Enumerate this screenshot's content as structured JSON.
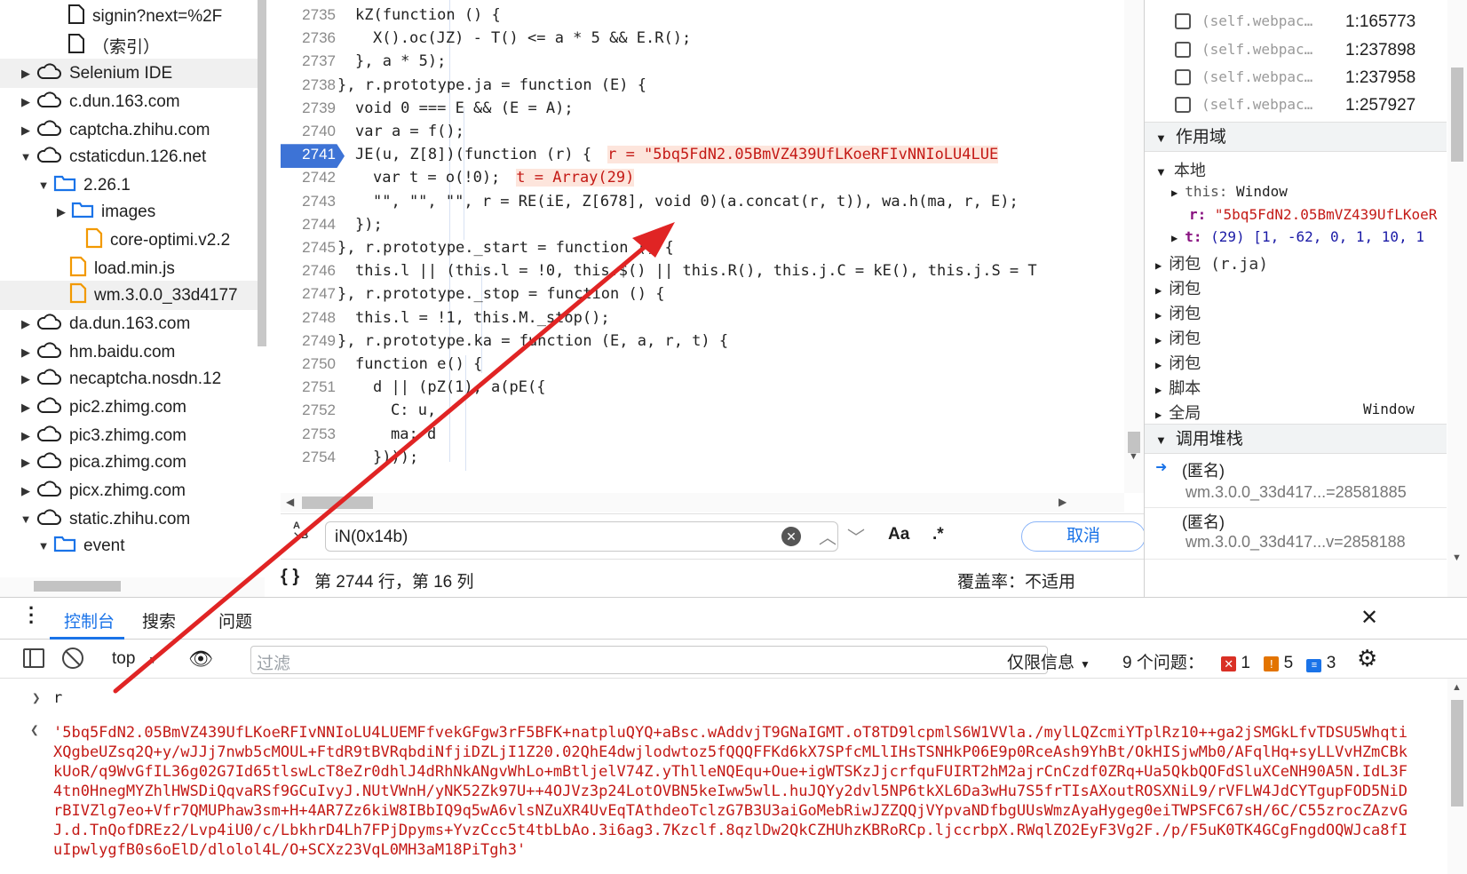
{
  "file_tree": {
    "items": [
      {
        "label": "signin?next=%2F",
        "type": "file",
        "indent": 0
      },
      {
        "label": "（索引）",
        "type": "file",
        "indent": 0
      },
      {
        "label": "Selenium IDE",
        "type": "cloud",
        "expanded": false,
        "selected": true
      },
      {
        "label": "c.dun.163.com",
        "type": "cloud",
        "expanded": false
      },
      {
        "label": "captcha.zhihu.com",
        "type": "cloud",
        "expanded": false
      },
      {
        "label": "cstaticdun.126.net",
        "type": "cloud",
        "expanded": true
      },
      {
        "label": "2.26.1",
        "type": "folder",
        "expanded": true
      },
      {
        "label": "images",
        "type": "folder",
        "expanded": false
      },
      {
        "label": "core-optimi.v2.2",
        "type": "file-js"
      },
      {
        "label": "load.min.js",
        "type": "file-js"
      },
      {
        "label": "wm.3.0.0_33d4177",
        "type": "file-js",
        "selected": true
      },
      {
        "label": "da.dun.163.com",
        "type": "cloud",
        "expanded": false
      },
      {
        "label": "hm.baidu.com",
        "type": "cloud",
        "expanded": false
      },
      {
        "label": "necaptcha.nosdn.12",
        "type": "cloud",
        "expanded": false
      },
      {
        "label": "pic2.zhimg.com",
        "type": "cloud",
        "expanded": false
      },
      {
        "label": "pic3.zhimg.com",
        "type": "cloud",
        "expanded": false
      },
      {
        "label": "pica.zhimg.com",
        "type": "cloud",
        "expanded": false
      },
      {
        "label": "picx.zhimg.com",
        "type": "cloud",
        "expanded": false
      },
      {
        "label": "static.zhihu.com",
        "type": "cloud",
        "expanded": true
      },
      {
        "label": "event",
        "type": "folder",
        "expanded": true
      }
    ]
  },
  "editor": {
    "line_numbers": [
      "2735",
      "2736",
      "2737",
      "2738",
      "2739",
      "2740",
      "2741",
      "2742",
      "2743",
      "2744",
      "2745",
      "2746",
      "2747",
      "2748",
      "2749",
      "2750",
      "2751",
      "2752",
      "2753",
      "2754"
    ],
    "breakpoint_line": "2741",
    "lines": {
      "l2735": "kZ(function () {",
      "l2736": "X().oc(JZ) - T() <= a * 5 && E.R();",
      "l2737": "}, a * 5);",
      "l2738": "}, r.prototype.ja = function (E) {",
      "l2739": "void 0 === E && (E = A);",
      "l2740": "var a = f();",
      "l2741": "JE(u, Z[8])(function (r) {",
      "l2741_inline": "r = \"5bq5FdN2.05BmVZ439UfLKoeRFIvNNIoLU4LUE",
      "l2742": "var t = o(!0);",
      "l2742_inline": "t = Array(29)",
      "l2743": "\"\", \"\", \"\", r = RE(iE, Z[678], void 0)(a.concat(r, t)), wa.h(ma, r, E);",
      "l2744": "});",
      "l2745": "}, r.prototype._start = function () {",
      "l2746": "this.l || (this.l = !0, this.$() || this.R(), this.j.C = kE(), this.j.S = T",
      "l2747": "}, r.prototype._stop = function () {",
      "l2748": "this.l = !1, this.M._stop();",
      "l2749": "}, r.prototype.ka = function (E, a, r, t) {",
      "l2750": "function e() {",
      "l2751": "d || (pZ(1), a(pE({",
      "l2752": "C: u,",
      "l2753": "ma: d",
      "l2754": "})));"
    }
  },
  "search": {
    "value": "iN(0x14b)",
    "case_label": "Aa",
    "regex_label": ".*",
    "cancel_label": "取消"
  },
  "status": {
    "position": "第 2744 行，第 16 列",
    "coverage": "覆盖率：不适用"
  },
  "right_panel": {
    "breakpoints": [
      {
        "label": "(self.webpac…",
        "loc": "1:165773"
      },
      {
        "label": "(self.webpac…",
        "loc": "1:237898"
      },
      {
        "label": "(self.webpac…",
        "loc": "1:237958"
      },
      {
        "label": "(self.webpac…",
        "loc": "1:257927"
      }
    ],
    "scope_header": "作用域",
    "local_label": "本地",
    "this_label": "this:",
    "this_value": "Window",
    "r_label": "r:",
    "r_value": "\"5bq5FdN2.05BmVZ439UfLKoeR",
    "t_label": "t:",
    "t_value": "(29)  [1, -62, 0, 1, 10, 1",
    "closure_ja": "闭包 (r.ja)",
    "closure": "闭包",
    "script": "脚本",
    "global": "全局",
    "global_value": "Window",
    "callstack_header": "调用堆栈",
    "frames": [
      {
        "name": "(匿名)",
        "loc": "wm.3.0.0_33d417...=28581885"
      },
      {
        "name": "(匿名)",
        "loc": "wm.3.0.0_33d417...v=2858188"
      }
    ]
  },
  "console_tabs": {
    "console": "控制台",
    "search": "搜索",
    "issues": "问题"
  },
  "console_toolbar": {
    "context": "top",
    "filter_placeholder": "过滤",
    "levels": "仅限信息",
    "issues_label": "9 个问题：",
    "err_count": "1",
    "warn_count": "5",
    "info_count": "3"
  },
  "console": {
    "input": "r",
    "output": "'5bq5FdN2.05BmVZ439UfLKoeRFIvNNIoLU4LUEMFfvekGFgw3rF5BFK+natpluQYQ+aBsc.wAddvjT9GNaIGMT.oT8TD9lcpmlS6W1VVla./mylLQZcmiYTplRz10++ga2jSMGkLfvTDSU5WhqtiXQgbeUZsq2Q+y/wJJj7nwb5cMOUL+FtdR9tBVRqbdiNfjiDZLjI1Z20.02QhE4dwjlodwtoz5fQQQFFKd6kX7SPfcMLlIHsTSNHkP06E9p0RceAsh9YhBt/OkHISjwMb0/AFqlHq+syLLVvHZmCBkkUoR/q9WvGfIL36g02G7Id65tlswLcT8eZr0dhlJ4dRhNkANgvWhLo+mBtljelV74Z.yThlleNQEqu+Oue+igWTSKzJjcrfquFUIRT2hM2ajrCnCzdf0ZRq+Ua5QkbQOFdSluXCeNH90A5N.IdL3F4tn0HnegMYZhlHWSDiQqvaRSf9GCuIvyJ.NUtVWnH/yNK52Zk97U++4OJVz3p24LotOVBN5keIww5wlL.huJQYy2dvl5NP6tkXL6Da3wHu7S5frTIsAXoutROSXNiL9/rVFLW4JdCYTgupFOD5NiDrBIVZlg7eo+Vfr7QMUPhaw3sm+H+4AR7Zz6kiW8IBbIQ9q5wA6vlsNZuXR4UvEqTAthdeoTclzG7B3U3aiGoMebRiwJZZQQjVYpvaNDfbgUUsWmzAyaHygeg0eiTWPSFC67sH/6C/C55zrocZAzvGJ.d.TnQofDREz2/Lvp4iU0/c/LbkhrD4Lh7FPjDpyms+YvzCcc5t4tbLbAo.3i6ag3.7Kzclf.8qzlDw2QkCZHUhzKBRoRCp.ljccrbpX.RWqlZO2EyF3Vg2F./p/F5uK0TK4GCgFngdOQWJca8fIuIpwlygfB0s6oElD/dlolol4L/O+SCXz23VqL0MH3aM18PiTgh3'"
  },
  "colors": {
    "accent": "#1a73e8",
    "error_red": "#c41a16",
    "arrow_red": "#e02424",
    "breakpoint_blue": "#3d73d6"
  }
}
